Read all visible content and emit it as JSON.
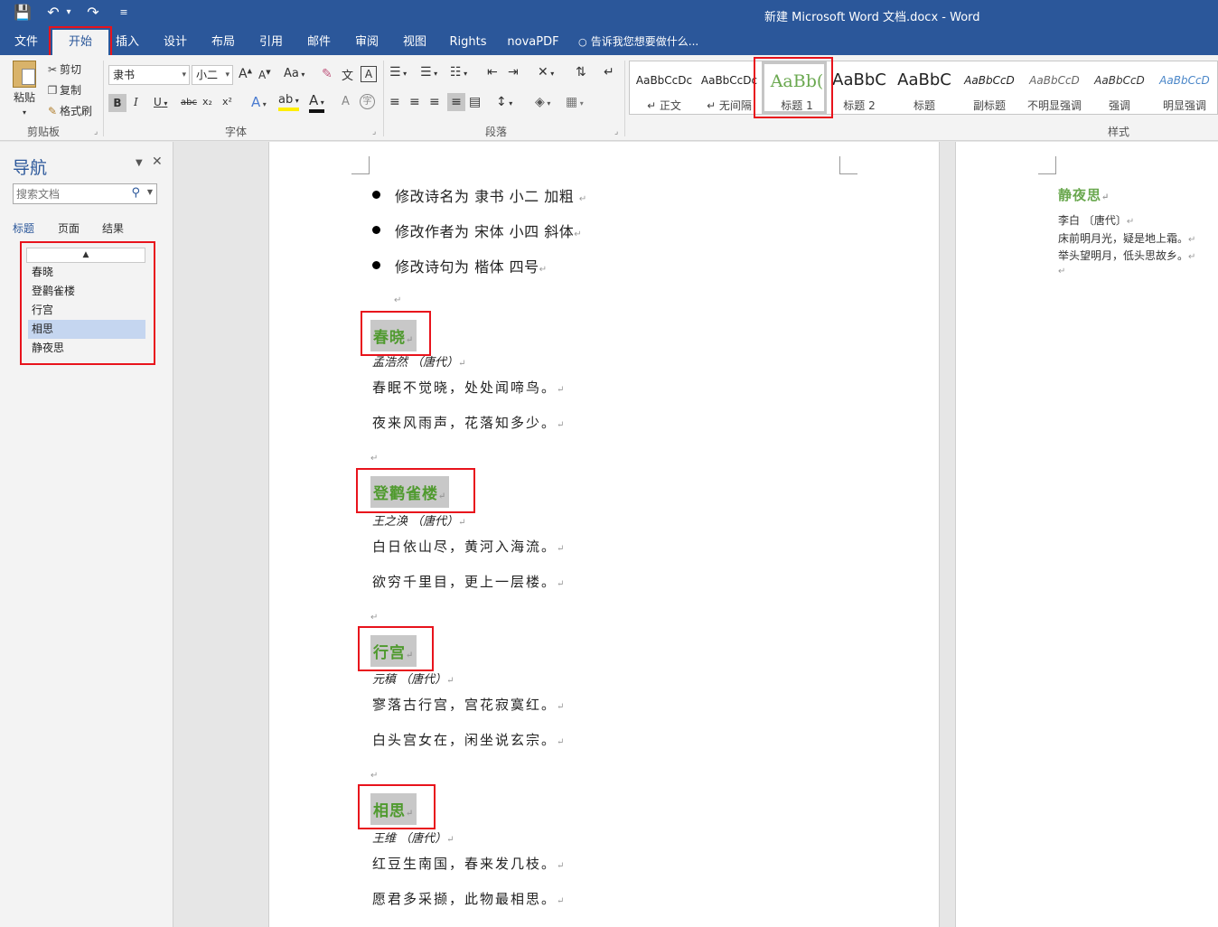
{
  "window": {
    "title": "新建 Microsoft Word 文档.docx - Word"
  },
  "qat": {
    "save": "💾",
    "undo": "↶",
    "undo_more": "▾",
    "redo": "↷",
    "customize": "≡"
  },
  "menu": {
    "tabs": [
      "文件",
      "开始",
      "插入",
      "设计",
      "布局",
      "引用",
      "邮件",
      "审阅",
      "视图",
      "Rights",
      "novaPDF"
    ],
    "active": "开始",
    "tell_me": "告诉我您想要做什么...",
    "tell_me_icon": "lightbulb-icon"
  },
  "ribbon": {
    "clipboard": {
      "label": "剪贴板",
      "paste": "粘贴",
      "cut": "剪切",
      "copy": "复制",
      "format_painter": "格式刷"
    },
    "font": {
      "label": "字体",
      "font_name": "隶书",
      "font_size": "小二",
      "grow": "A",
      "shrink": "A",
      "change_case": "Aa",
      "bold": "B",
      "italic": "I",
      "underline": "U",
      "strike": "abc",
      "subscript": "x₂",
      "superscript": "x²"
    },
    "paragraph": {
      "label": "段落"
    },
    "styles": {
      "label": "样式",
      "items": [
        {
          "sample": "AaBbCcDc",
          "name": "↵ 正文"
        },
        {
          "sample": "AaBbCcDc",
          "name": "↵ 无间隔"
        },
        {
          "sample": "AaBb(",
          "name": "标题 1"
        },
        {
          "sample": "AaBbC",
          "name": "标题 2"
        },
        {
          "sample": "AaBbC",
          "name": "标题"
        },
        {
          "sample": "AaBbCcD",
          "name": "副标题"
        },
        {
          "sample": "AaBbCcD",
          "name": "不明显强调"
        },
        {
          "sample": "AaBbCcD",
          "name": "强调"
        },
        {
          "sample": "AaBbCcD",
          "name": "明显强调"
        }
      ],
      "selected": "标题 1",
      "accent": "#6aa84f"
    }
  },
  "nav": {
    "title": "导航",
    "search_placeholder": "搜索文档",
    "tabs": [
      "标题",
      "页面",
      "结果"
    ],
    "collapse": "▲",
    "headings": [
      "春晓",
      "登鹳雀楼",
      "行宫",
      "相思",
      "静夜思"
    ],
    "selected": "相思"
  },
  "document": {
    "bullets": [
      "修改诗名为 隶书 小二 加粗",
      "修改作者为 宋体 小四 斜体",
      "修改诗句为 楷体 四号"
    ],
    "para_mark": "↵",
    "poems": [
      {
        "title": "春晓",
        "author": "孟浩然 （唐代）",
        "lines": [
          "春眠不觉晓，处处闻啼鸟。",
          "夜来风雨声，花落知多少。"
        ]
      },
      {
        "title": "登鹳雀楼",
        "author": "王之涣 （唐代）",
        "lines": [
          "白日依山尽，黄河入海流。",
          "欲穷千里目，更上一层楼。"
        ]
      },
      {
        "title": "行宫",
        "author": "元稹 （唐代）",
        "lines": [
          "寥落古行宫，宫花寂寞红。",
          "白头宫女在，闲坐说玄宗。"
        ]
      },
      {
        "title": "相思",
        "author": "王维 （唐代）",
        "lines": [
          "红豆生南国，春来发几枝。",
          "愿君多采撷，此物最相思。"
        ]
      }
    ],
    "page2": {
      "title": "静夜思",
      "author": "李白 〔唐代〕",
      "lines": [
        "床前明月光，疑是地上霜。",
        "举头望明月，低头思故乡。"
      ]
    }
  }
}
